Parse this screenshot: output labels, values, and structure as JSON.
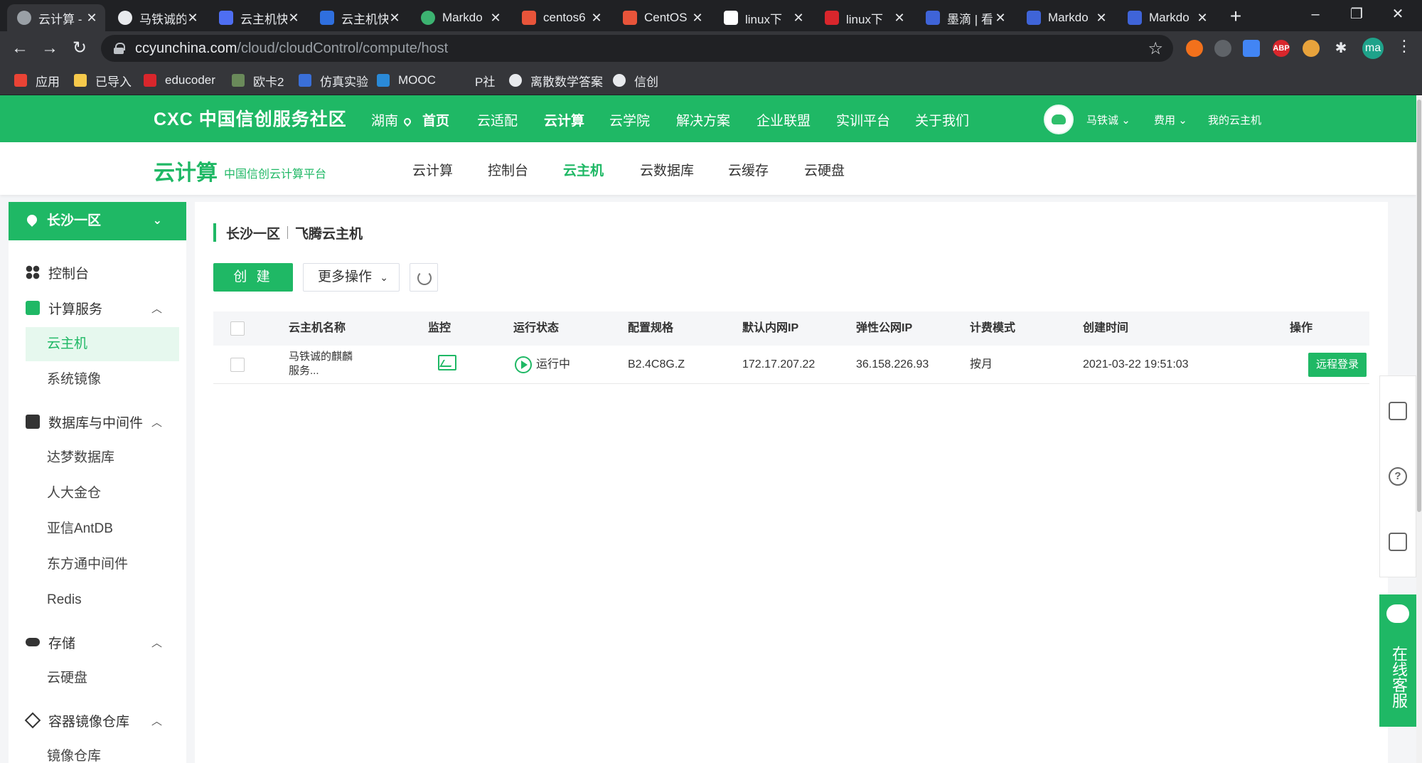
{
  "browser": {
    "tabs": [
      {
        "title": "云计算 -",
        "color": "#9aa0a6",
        "active": true
      },
      {
        "title": "马铁诚的",
        "color": "#e8eaed"
      },
      {
        "title": "云主机快",
        "color": "#4e6ef2"
      },
      {
        "title": "云主机快",
        "color": "#2f6fde"
      },
      {
        "title": "Markdo",
        "color": "#3cb371"
      },
      {
        "title": "centos6",
        "color": "#e8543a"
      },
      {
        "title": "CentOS",
        "color": "#e8543a"
      },
      {
        "title": "linux下",
        "color": "#ffffff"
      },
      {
        "title": "linux下",
        "color": "#d9262c"
      },
      {
        "title": "墨滴 | 看",
        "color": "#3f64d8"
      },
      {
        "title": "Markdo",
        "color": "#3f64d8"
      },
      {
        "title": "Markdo",
        "color": "#3f64d8"
      }
    ],
    "url_host": "ccyunchina.com",
    "url_path": "/cloud/cloudControl/compute/host",
    "profile_initials": "ma",
    "bookmarks": [
      {
        "label": "应用",
        "color": "#ea4335"
      },
      {
        "label": "已导入",
        "color": "#f6c94b"
      },
      {
        "label": "educoder",
        "color": "#d9262c"
      },
      {
        "label": "欧卡2",
        "color": "#6a8a5a"
      },
      {
        "label": "仿真实验",
        "color": "#3a6fd8"
      },
      {
        "label": "MOOC",
        "color": "#2a8ad8"
      },
      {
        "label": "P社",
        "color": "#35363a"
      },
      {
        "label": "离散数学答案",
        "color": "#e8eaed"
      },
      {
        "label": "信创",
        "color": "#e8eaed"
      }
    ]
  },
  "site": {
    "logo": "CXC 中国信创服务社区",
    "nav": [
      "湖南",
      "首页",
      "云适配",
      "云计算",
      "云学院",
      "解决方案",
      "企业联盟",
      "实训平台",
      "关于我们"
    ],
    "user": "马铁诚",
    "fee": "费用",
    "my_host": "我的云主机",
    "brand_color": "#1fb865"
  },
  "subheader": {
    "brand": "云计算",
    "brand_sub": "中国信创云计算平台",
    "nav": [
      "云计算",
      "控制台",
      "云主机",
      "云数据库",
      "云缓存",
      "云硬盘"
    ],
    "active": "云主机"
  },
  "sidebar": {
    "region": "长沙一区",
    "groups": [
      {
        "label": "控制台",
        "icon": "dashboard-icon"
      },
      {
        "label": "计算服务",
        "icon": "compute-icon",
        "items": [
          "云主机",
          "系统镜像"
        ]
      },
      {
        "label": "数据库与中间件",
        "icon": "database-icon",
        "items": [
          "达梦数据库",
          "人大金仓",
          "亚信AntDB",
          "东方通中间件",
          "Redis"
        ]
      },
      {
        "label": "存储",
        "icon": "cloud-storage-icon",
        "items": [
          "云硬盘"
        ]
      },
      {
        "label": "容器镜像仓库",
        "icon": "container-icon",
        "items": [
          "镜像仓库"
        ]
      }
    ],
    "active_item": "云主机"
  },
  "main": {
    "crumb_region": "长沙一区",
    "crumb_product": "飞腾云主机",
    "create_label": "创 建",
    "more_label": "更多操作",
    "columns": [
      "云主机名称",
      "监控",
      "运行状态",
      "配置规格",
      "默认内网IP",
      "弹性公网IP",
      "计费模式",
      "创建时间",
      "操作"
    ],
    "rows": [
      {
        "name_line1": "马铁诚的麒麟",
        "name_line2": "服务...",
        "status": "运行中",
        "spec": "B2.4C8G.Z",
        "private_ip": "172.17.207.22",
        "public_ip": "36.158.226.93",
        "billing": "按月",
        "created": "2021-03-22 19:51:03",
        "action": "远程登录"
      }
    ]
  },
  "float": {
    "chat_label": "在线客服"
  }
}
